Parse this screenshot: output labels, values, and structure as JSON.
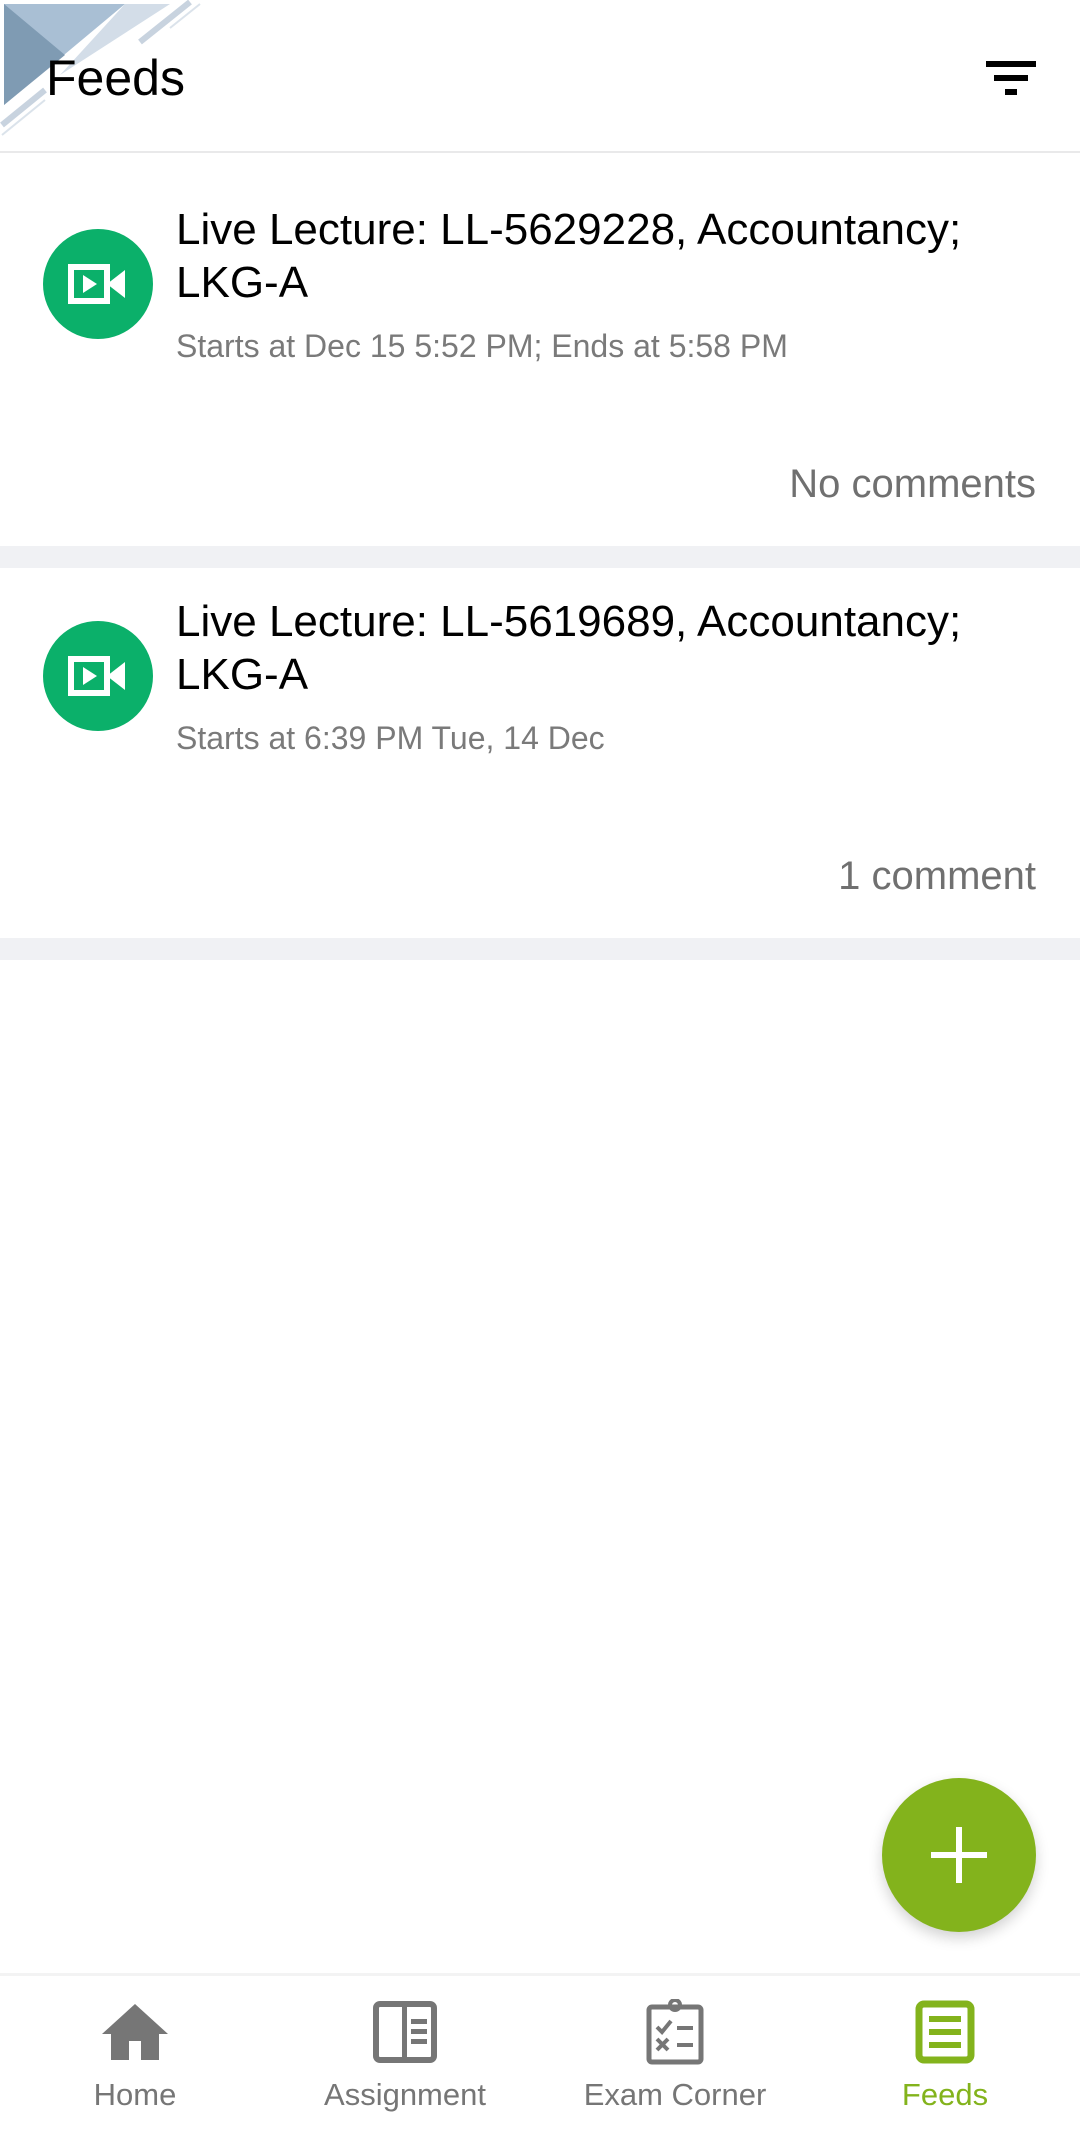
{
  "header": {
    "title": "Feeds",
    "filter_icon": "filter-icon"
  },
  "feed": [
    {
      "icon": "video-camera-icon",
      "title": "Live Lecture: LL-5629228, Accountancy; LKG-A",
      "subtitle": "Starts at Dec 15 5:52 PM; Ends at 5:58 PM",
      "comments": "No comments"
    },
    {
      "icon": "video-camera-icon",
      "title": "Live Lecture: LL-5619689, Accountancy; LKG-A",
      "subtitle": "Starts at 6:39 PM Tue, 14 Dec",
      "comments": "1 comment"
    }
  ],
  "fab": {
    "icon": "plus-icon"
  },
  "bottom_nav": {
    "items": [
      {
        "label": "Home",
        "icon": "home-icon",
        "active": false
      },
      {
        "label": "Assignment",
        "icon": "assignment-icon",
        "active": false
      },
      {
        "label": "Exam Corner",
        "icon": "exam-clipboard-icon",
        "active": false
      },
      {
        "label": "Feeds",
        "icon": "feeds-icon",
        "active": true
      }
    ]
  },
  "colors": {
    "accent": "#83b31c",
    "live_lecture": "#0bb06a",
    "muted_text": "#7a7a7a",
    "divider": "#f0f1f4"
  }
}
